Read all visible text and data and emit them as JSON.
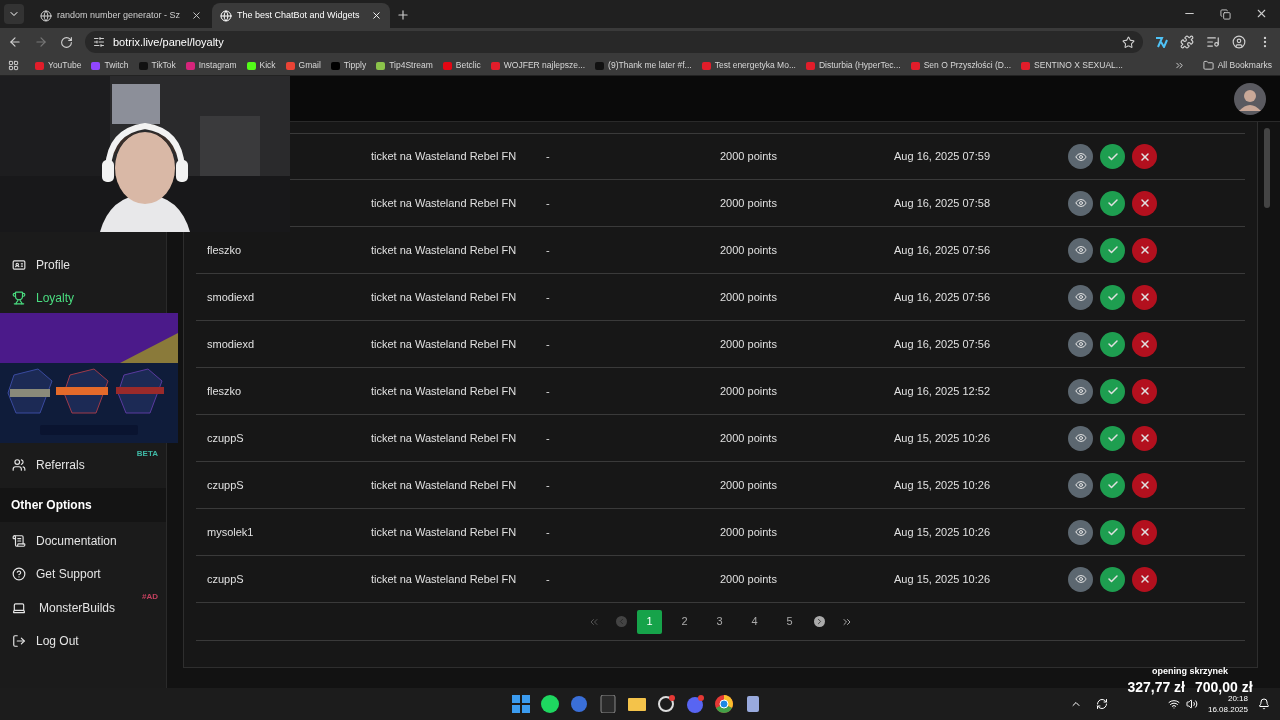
{
  "browser": {
    "tabs": [
      {
        "title": "random number generator - Sz",
        "selected": false
      },
      {
        "title": "The best ChatBot and Widgets",
        "selected": true
      }
    ],
    "url": "botrix.live/panel/loyalty",
    "bookmarks": [
      {
        "label": "YouTube",
        "color": "#e11d2a"
      },
      {
        "label": "Twitch",
        "color": "#9146ff"
      },
      {
        "label": "TikTok",
        "color": "#111111"
      },
      {
        "label": "Instagram",
        "color": "#d6247b"
      },
      {
        "label": "Kick",
        "color": "#53fc18"
      },
      {
        "label": "Gmail",
        "color": "#ea4335"
      },
      {
        "label": "Tipply",
        "color": "#000000"
      },
      {
        "label": "Tip4Stream",
        "color": "#8bc34a"
      },
      {
        "label": "Betclic",
        "color": "#e30613"
      },
      {
        "label": "WOJFER najlepsze...",
        "color": "#e11d2a"
      },
      {
        "label": "(9)Thank me later #f...",
        "color": "#111111"
      },
      {
        "label": "Test energetyka Mo...",
        "color": "#e11d2a"
      },
      {
        "label": "Disturbia (HyperTec...",
        "color": "#e11d2a"
      },
      {
        "label": "Sen O Przyszłości (D...",
        "color": "#e11d2a"
      },
      {
        "label": "SENTINO X SEXUAL...",
        "color": "#e11d2a"
      }
    ],
    "all_bookmarks": "All Bookmarks"
  },
  "sidebar": {
    "items": [
      {
        "label": "Profile",
        "selected": false
      },
      {
        "label": "Loyalty",
        "selected": true
      },
      {
        "label": "Referrals",
        "selected": false,
        "badge": {
          "text": "BETA",
          "color": "#3fb8a5"
        }
      }
    ],
    "section_title": "Other Options",
    "other_items": [
      {
        "label": "Documentation"
      },
      {
        "label": "Get Support"
      },
      {
        "label": "MonsterBuilds",
        "badge": {
          "text": "#AD",
          "color": "#c2405e"
        }
      },
      {
        "label": "Log Out"
      }
    ]
  },
  "table": {
    "rows": [
      {
        "reward": "ticket na Wasteland Rebel FN",
        "note": "-",
        "cost": "2000 points",
        "date": "Aug 16, 2025 07:59"
      },
      {
        "reward": "ticket na Wasteland Rebel FN",
        "note": "-",
        "cost": "2000 points",
        "date": "Aug 16, 2025 07:58"
      },
      {
        "user": "fleszko",
        "reward": "ticket na Wasteland Rebel FN",
        "note": "-",
        "cost": "2000 points",
        "date": "Aug 16, 2025 07:56"
      },
      {
        "user": "smodiexd",
        "reward": "ticket na Wasteland Rebel FN",
        "note": "-",
        "cost": "2000 points",
        "date": "Aug 16, 2025 07:56"
      },
      {
        "user": "smodiexd",
        "reward": "ticket na Wasteland Rebel FN",
        "note": "-",
        "cost": "2000 points",
        "date": "Aug 16, 2025 07:56"
      },
      {
        "user": "fleszko",
        "reward": "ticket na Wasteland Rebel FN",
        "note": "-",
        "cost": "2000 points",
        "date": "Aug 16, 2025 12:52"
      },
      {
        "user": "czuppS",
        "reward": "ticket na Wasteland Rebel FN",
        "note": "-",
        "cost": "2000 points",
        "date": "Aug 15, 2025 10:26"
      },
      {
        "user": "czuppS",
        "reward": "ticket na Wasteland Rebel FN",
        "note": "-",
        "cost": "2000 points",
        "date": "Aug 15, 2025 10:26"
      },
      {
        "user": "mysolek1",
        "reward": "ticket na Wasteland Rebel FN",
        "note": "-",
        "cost": "2000 points",
        "date": "Aug 15, 2025 10:26"
      },
      {
        "user": "czuppS",
        "reward": "ticket na Wasteland Rebel FN",
        "note": "-",
        "cost": "2000 points",
        "date": "Aug 15, 2025 10:26"
      }
    ]
  },
  "pagination": {
    "pages": [
      {
        "label": "1",
        "selected": true
      },
      {
        "label": "2",
        "selected": false
      },
      {
        "label": "3",
        "selected": false
      },
      {
        "label": "4",
        "selected": false
      },
      {
        "label": "5",
        "selected": false
      }
    ]
  },
  "stream_overlay": {
    "title": "opening skrzynek",
    "amount": "327,77 zł",
    "goal": "700,00 zł"
  },
  "taskbar": {
    "time": "20:18",
    "date": "16.08.2025"
  }
}
